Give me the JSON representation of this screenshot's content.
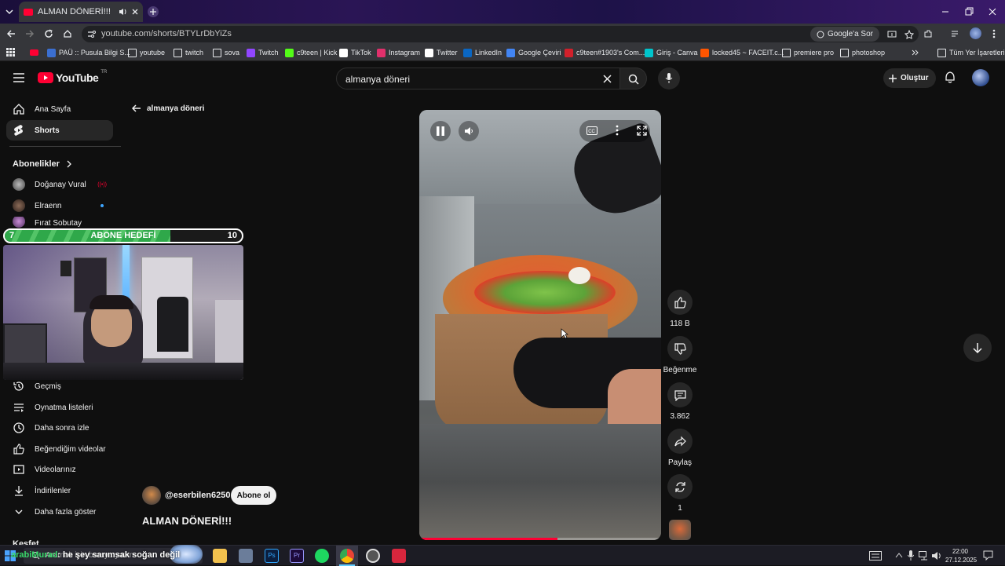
{
  "browser": {
    "tab_title": "ALMAN DÖNERİ!!! - YouTube",
    "url": "youtube.com/shorts/BTYLrDbYiZs",
    "google_sor": "Google'a Sor",
    "bookmarks": [
      {
        "label": "PAÜ :: Pusula Bilgi S...",
        "color": "#3b6fd1"
      },
      {
        "label": "youtube",
        "color": "folder"
      },
      {
        "label": "twitch",
        "color": "folder"
      },
      {
        "label": "sova",
        "color": "folder"
      },
      {
        "label": "Twitch",
        "color": "#9146ff"
      },
      {
        "label": "c9teen | Kick",
        "color": "#53fc18"
      },
      {
        "label": "TikTok",
        "color": "#ffffff"
      },
      {
        "label": "Instagram",
        "color": "#e1306c"
      },
      {
        "label": "Twitter",
        "color": "#ffffff"
      },
      {
        "label": "LinkedIn",
        "color": "#0a66c2"
      },
      {
        "label": "Google Çeviri",
        "color": "#4285f4"
      },
      {
        "label": "c9teen#1903's Com...",
        "color": "#d1202b"
      },
      {
        "label": "Giriş - Canva",
        "color": "#00c4cc"
      },
      {
        "label": "locked45 ~ FACEIT.c...",
        "color": "#ff5500"
      },
      {
        "label": "premiere pro",
        "color": "folder"
      },
      {
        "label": "photoshop",
        "color": "folder"
      }
    ],
    "all_bookmarks": "Tüm Yer İşaretleri"
  },
  "header": {
    "logo": "YouTube",
    "region": "TR",
    "search_value": "almanya döneri",
    "create_label": "Oluştur"
  },
  "sidebar": {
    "home": "Ana Sayfa",
    "shorts": "Shorts",
    "subs_title": "Abonelikler",
    "subs": [
      "Doğanay Vural",
      "Elraenn",
      "Fırat Sobutay"
    ],
    "live_badge": "((•))",
    "you_items": [
      "Geçmiş",
      "Oynatma listeleri",
      "Daha sonra izle",
      "Beğendiğim videolar",
      "Videolarınız",
      "İndirilenler",
      "Daha fazla göster"
    ],
    "explore": "Keşfet"
  },
  "overlay": {
    "goal_label": "ABONE HEDEFİ",
    "goal_current": "7",
    "goal_target": "10",
    "goal_progress": 0.7,
    "chat_user": "arabiMurad",
    "chat_text": ": he şey sarımsak soğan değil"
  },
  "shorts": {
    "back_query": "almanya döneri",
    "channel": "@eserbilen6250",
    "subscribe": "Abone ol",
    "title": "ALMAN DÖNERİ!!!",
    "likes": "118 B",
    "dislike_label": "Beğenme",
    "comments": "3.862",
    "share_label": "Paylaş",
    "remix_count": "1",
    "playback_progress": 0.57
  },
  "taskbar": {
    "search_placeholder": "Aramak için buraya yazın",
    "time": "22:00",
    "date": "27.12.2025"
  },
  "colors": {
    "youtube_red": "#ff0033",
    "goal_green": "#2fa84a"
  }
}
